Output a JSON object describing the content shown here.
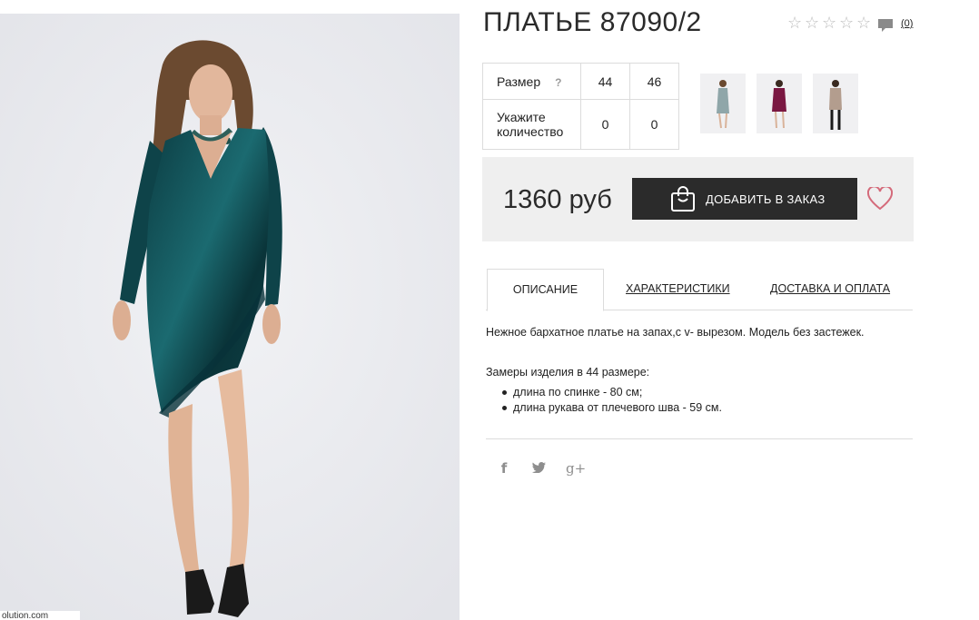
{
  "product": {
    "title": "ПЛАТЬЕ 87090/2",
    "review_count": "(0)",
    "rating_stars": 5,
    "watermark": "olution.com"
  },
  "sizes": {
    "size_label": "Размер",
    "help": "?",
    "qty_label": "Укажите количество",
    "options": [
      {
        "size": "44",
        "qty": "0"
      },
      {
        "size": "46",
        "qty": "0"
      }
    ]
  },
  "thumbnails": [
    {
      "color": "#8fa6a9"
    },
    {
      "color": "#7a1842"
    },
    {
      "color": "#b39d8e"
    }
  ],
  "purchase": {
    "price": "1360 руб",
    "add_button": "ДОБАВИТЬ В ЗАКАЗ"
  },
  "tabs": [
    {
      "label": "ОПИСАНИЕ",
      "active": true
    },
    {
      "label": "ХАРАКТЕРИСТИКИ",
      "active": false
    },
    {
      "label": "ДОСТАВКА И ОПЛАТА",
      "active": false
    }
  ],
  "description": {
    "text": "Нежное бархатное платье на запах,с v- вырезом. Модель без застежек.",
    "measurements_title": "Замеры изделия в 44 размере:",
    "measurements": [
      "длина по спинке - 80 см;",
      "длина рукава от плечевого шва - 59 см."
    ]
  },
  "social": [
    "f",
    "t",
    "g+"
  ],
  "colors": {
    "dress": "#0f4a50",
    "button": "#2b2b2b",
    "heart": "#d46a7a"
  }
}
